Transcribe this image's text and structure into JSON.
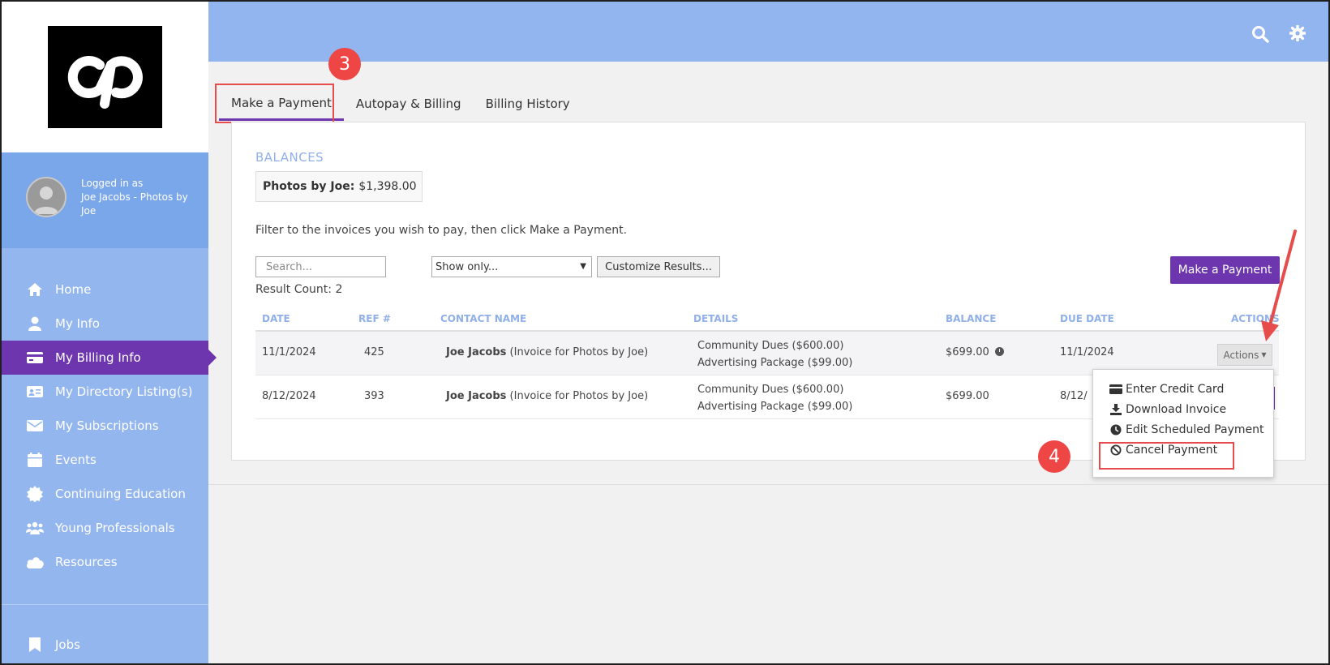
{
  "sidebar": {
    "user": {
      "logged_in_as": "Logged in as",
      "name": "Joe Jacobs - Photos by Joe"
    },
    "items": [
      {
        "label": "Home",
        "icon": "home-icon"
      },
      {
        "label": "My Info",
        "icon": "user-icon"
      },
      {
        "label": "My Billing Info",
        "icon": "credit-card-icon",
        "active": true
      },
      {
        "label": "My Directory Listing(s)",
        "icon": "id-card-icon"
      },
      {
        "label": "My Subscriptions",
        "icon": "envelope-icon"
      },
      {
        "label": "Events",
        "icon": "calendar-icon"
      },
      {
        "label": "Continuing Education",
        "icon": "certificate-icon"
      },
      {
        "label": "Young Professionals",
        "icon": "users-icon"
      },
      {
        "label": "Resources",
        "icon": "cloud-icon"
      }
    ],
    "bottom_item": {
      "label": "Jobs",
      "icon": "bookmark-icon"
    }
  },
  "topbar": {
    "icons": [
      "search-icon",
      "gear-icon"
    ]
  },
  "tabs": [
    {
      "label": "Make a Payment",
      "active": true
    },
    {
      "label": "Autopay & Billing"
    },
    {
      "label": "Billing History"
    }
  ],
  "annotations": {
    "step3": "3",
    "step4": "4"
  },
  "balances": {
    "title": "BALANCES",
    "name": "Photos by Joe:",
    "amount": "$1,398.00"
  },
  "filter_text": "Filter to the invoices you wish to pay, then click Make a Payment.",
  "search": {
    "placeholder": "Search..."
  },
  "show_only": {
    "value": "Show only..."
  },
  "customize_label": "Customize Results...",
  "result_count": "Result Count: 2",
  "make_payment_label": "Make a Payment",
  "table": {
    "headers": [
      "DATE",
      "REF #",
      "CONTACT NAME",
      "DETAILS",
      "BALANCE",
      "DUE DATE",
      "ACTIONS"
    ],
    "rows": [
      {
        "date": "11/1/2024",
        "ref": "425",
        "contact_name": "Joe Jacobs",
        "contact_note": "(Invoice for Photos by Joe)",
        "details": [
          "Community Dues ($600.00)",
          "Advertising Package ($99.00)"
        ],
        "balance": "$699.00",
        "due_date": "11/1/2024",
        "actions": "Actions"
      },
      {
        "date": "8/12/2024",
        "ref": "393",
        "contact_name": "Joe Jacobs",
        "contact_note": "(Invoice for Photos by Joe)",
        "details": [
          "Community Dues ($600.00)",
          "Advertising Package ($99.00)"
        ],
        "balance": "$699.00",
        "due_date": "8/12/"
      }
    ]
  },
  "dropdown": {
    "items": [
      {
        "label": "Enter Credit Card",
        "icon": "credit-card-icon"
      },
      {
        "label": "Download Invoice",
        "icon": "download-icon"
      },
      {
        "label": "Edit Scheduled Payment",
        "icon": "clock-icon"
      },
      {
        "label": "Cancel Payment",
        "icon": "ban-icon"
      }
    ]
  },
  "colors": {
    "accent": "#6d36ae",
    "sidebar": "#94b6ef",
    "topbar": "#92b4ef",
    "header_text": "#8fb0e8",
    "annotation": "#ee4545"
  }
}
